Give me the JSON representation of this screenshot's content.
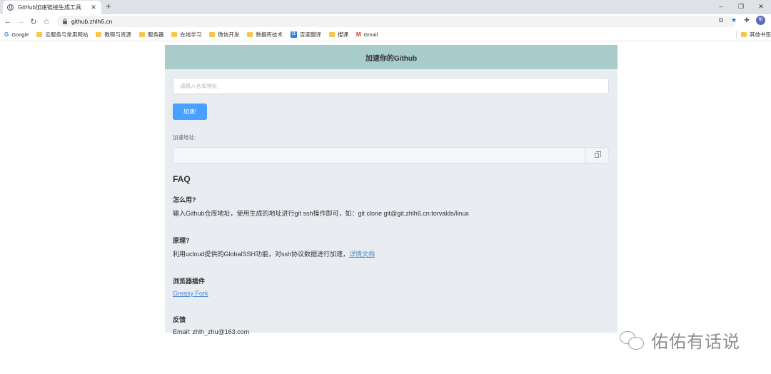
{
  "browser": {
    "tab_title": "GitHub加速链接生成工具",
    "tab_close": "✕",
    "new_tab": "+",
    "window_buttons": [
      "–",
      "❐",
      "✕"
    ],
    "url": "github.zhlh6.cn",
    "avatar_initial": "佑"
  },
  "bookmarks": [
    {
      "label": "Google",
      "type": "google",
      "icon": "G"
    },
    {
      "label": "云服务与常用网站",
      "type": "folder"
    },
    {
      "label": "教程与资源",
      "type": "folder"
    },
    {
      "label": "服务器",
      "type": "folder"
    },
    {
      "label": "在线学习",
      "type": "folder"
    },
    {
      "label": "微信开发",
      "type": "folder"
    },
    {
      "label": "数据库技术",
      "type": "folder"
    },
    {
      "label": "百度翻译",
      "type": "fanyi",
      "icon": "译"
    },
    {
      "label": "搜课",
      "type": "folder"
    },
    {
      "label": "Gmail",
      "type": "gmail",
      "icon": "M"
    }
  ],
  "bookmarks_other": "其他书签",
  "page": {
    "header": "加速你的Github",
    "repo_input_placeholder": "请输入仓库地址",
    "accelerate_button": "加速!",
    "result_label": "加速地址:",
    "result_value": "",
    "faq_title": "FAQ",
    "faq": [
      {
        "q": "怎么用?",
        "a": "输入Github仓库地址，使用生成的地址进行git ssh操作即可，如：git clone git@git.zhlh6.cn:torvalds/linux",
        "link": ""
      },
      {
        "q": "原理?",
        "a": "利用ucloud提供的GlobalSSH功能，对ssh协议数据进行加速，",
        "link": "详情文档"
      },
      {
        "q": "浏览器插件",
        "a": "",
        "link": "Greasy Fork"
      },
      {
        "q": "反馈",
        "a": "Email: zhlh_zhu@163.com",
        "link": ""
      }
    ]
  },
  "watermark": "佑佑有话说"
}
